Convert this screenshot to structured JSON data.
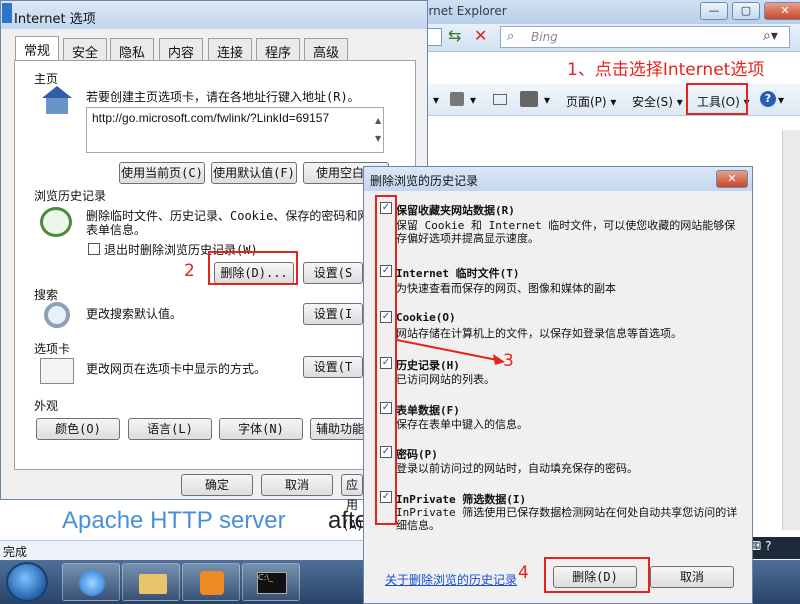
{
  "ie": {
    "title": "Apache HTTP Server Test Page powered by CentOS - Windows Internet Explorer",
    "search_placeholder": "Bing",
    "cmd_page": "页面(P)",
    "cmd_safety": "安全(S)",
    "cmd_tools": "工具(O)",
    "banner_left": "Apache HTTP server",
    "banner_right": "afte",
    "status": "完成"
  },
  "annotations": {
    "a1": "1、点击选择Internet选项",
    "a2": "2",
    "a3": "3",
    "a4": "4"
  },
  "inet": {
    "title": "Internet 选项",
    "tabs": [
      "常规",
      "安全",
      "隐私",
      "内容",
      "连接",
      "程序",
      "高级"
    ],
    "home": {
      "label": "主页",
      "desc": "若要创建主页选项卡，请在各地址行键入地址(R)。",
      "url": "http://go.microsoft.com/fwlink/?LinkId=69157",
      "btn_current": "使用当前页(C)",
      "btn_default": "使用默认值(F)",
      "btn_blank": "使用空白页"
    },
    "history": {
      "label": "浏览历史记录",
      "desc1": "删除临时文件、历史记录、Cookie、保存的密码和网",
      "desc2": "表单信息。",
      "exit_chk": "退出时删除浏览历史记录(W)",
      "btn_delete": "删除(D)...",
      "btn_settings": "设置(S"
    },
    "search": {
      "label": "搜索",
      "desc": "更改搜索默认值。",
      "btn": "设置(I"
    },
    "tabs_section": {
      "label": "选项卡",
      "desc": "更改网页在选项卡中显示的方式。",
      "btn": "设置(T"
    },
    "appearance": {
      "label": "外观",
      "btn_colors": "颜色(O)",
      "btn_lang": "语言(L)",
      "btn_fonts": "字体(N)",
      "btn_access": "辅助功能"
    },
    "btn_ok": "确定",
    "btn_cancel": "取消",
    "btn_apply": "应用(A)"
  },
  "del": {
    "title": "删除浏览的历史记录",
    "options": [
      {
        "title": "保留收藏夹网站数据(R)",
        "desc": "保留 Cookie 和 Internet 临时文件，可以使您收藏的网站能够保存偏好选项并提高显示速度。"
      },
      {
        "title": "Internet 临时文件(T)",
        "desc": "为快速查看而保存的网页、图像和媒体的副本"
      },
      {
        "title": "Cookie(O)",
        "desc": "网站存储在计算机上的文件，以保存如登录信息等首选项。"
      },
      {
        "title": "历史记录(H)",
        "desc": "已访问网站的列表。"
      },
      {
        "title": "表单数据(F)",
        "desc": "保存在表单中键入的信息。"
      },
      {
        "title": "密码(P)",
        "desc": "登录以前访问过的网站时，自动填充保存的密码。"
      },
      {
        "title": "InPrivate 筛选数据(I)",
        "desc": "InPrivate 筛选使用已保存数据检测网站在何处自动共享您访问的详细信息。"
      }
    ],
    "about_link": "关于删除浏览的历史记录",
    "btn_delete": "删除(D)",
    "btn_cancel": "取消"
  },
  "tray": {
    "lang": "CH"
  },
  "colors": {
    "annotation": "#e5231c",
    "link": "#1a4fd0"
  }
}
